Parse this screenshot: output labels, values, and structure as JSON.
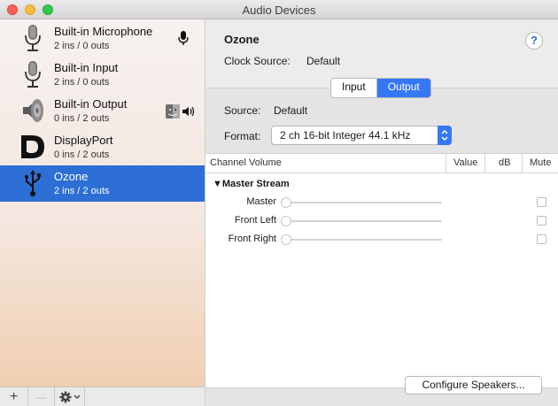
{
  "window": {
    "title": "Audio Devices"
  },
  "devices": [
    {
      "name": "Built-in Microphone",
      "sub": "2 ins / 0 outs",
      "icon": "microphone-icon",
      "badge": "microphone-badge-icon",
      "selected": false
    },
    {
      "name": "Built-in Input",
      "sub": "2 ins / 0 outs",
      "icon": "microphone-icon",
      "selected": false
    },
    {
      "name": "Built-in Output",
      "sub": "0 ins / 2 outs",
      "icon": "speaker-icon",
      "badge": "finder-speaker-badge-icon",
      "selected": false
    },
    {
      "name": "DisplayPort",
      "sub": "0 ins / 2 outs",
      "icon": "displayport-icon",
      "selected": false
    },
    {
      "name": "Ozone",
      "sub": "2 ins / 2 outs",
      "icon": "usb-icon",
      "selected": true
    }
  ],
  "bottombar": {
    "add": "+",
    "remove": "—"
  },
  "detail": {
    "device_name": "Ozone",
    "help": "?",
    "clock_label": "Clock Source:",
    "clock_value": "Default",
    "tabs": [
      {
        "label": "Input",
        "active": false
      },
      {
        "label": "Output",
        "active": true
      }
    ],
    "source_label": "Source:",
    "source_value": "Default",
    "format_label": "Format:",
    "format_value": "2 ch 16-bit Integer 44.1 kHz",
    "columns": {
      "channel_volume": "Channel Volume",
      "value": "Value",
      "db": "dB",
      "mute": "Mute"
    },
    "group": "Master Stream",
    "channels": [
      {
        "name": "Master"
      },
      {
        "name": "Front Left"
      },
      {
        "name": "Front Right"
      }
    ],
    "configure_button": "Configure Speakers..."
  },
  "colors": {
    "selection": "#2d6fd5",
    "accent": "#3478f6"
  }
}
